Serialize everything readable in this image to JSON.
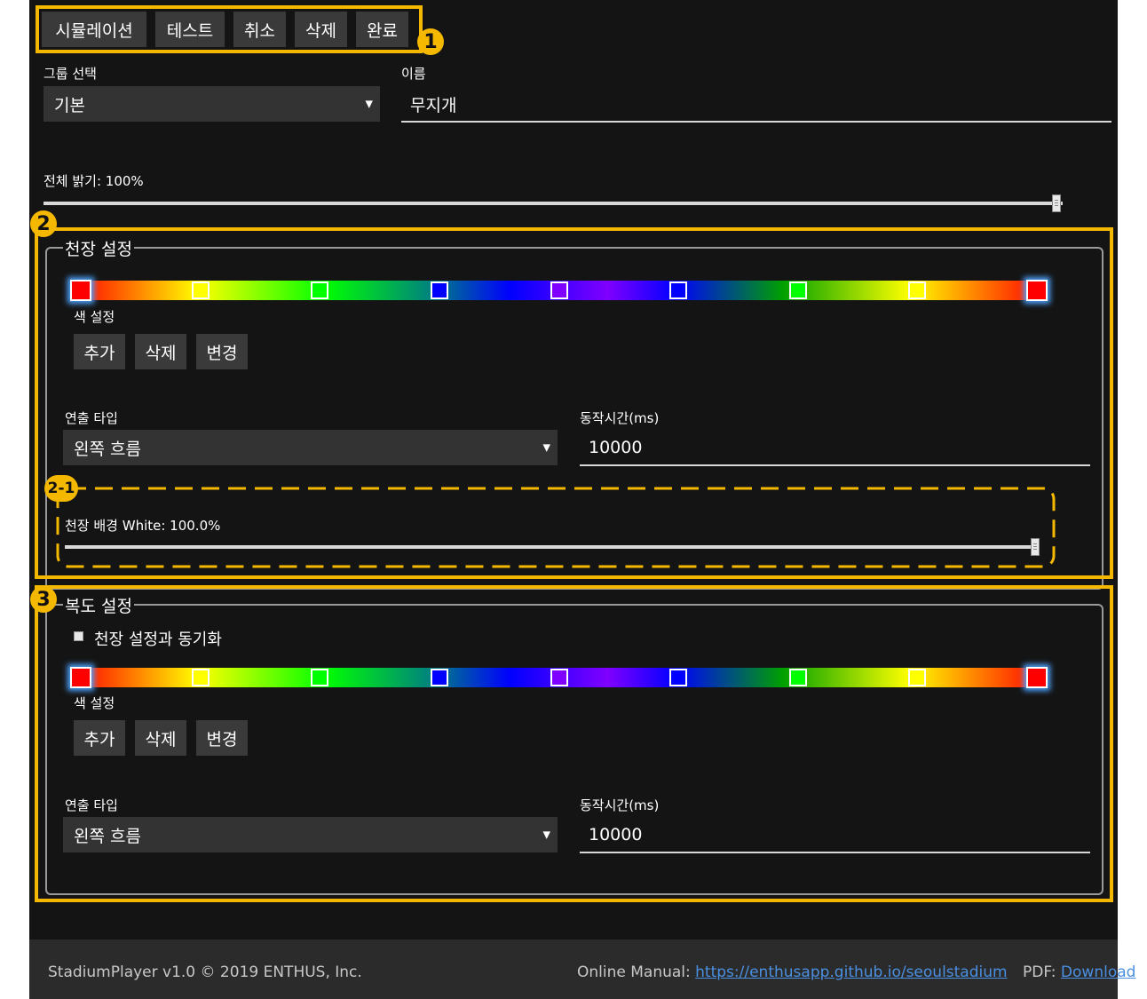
{
  "toolbar": {
    "simulation_label": "시뮬레이션",
    "test_label": "테스트",
    "cancel_label": "취소",
    "delete_label": "삭제",
    "done_label": "완료"
  },
  "form": {
    "group_label": "그룹 선택",
    "group_value": "기본",
    "name_label": "이름",
    "name_value": "무지개",
    "brightness_label": "전체 밝기: 100%",
    "brightness_value": 1.0
  },
  "ceiling": {
    "legend": "천장 설정",
    "color_stops": [
      "#ff0000",
      "#ffff00",
      "#00ff00",
      "#0000ff",
      "#8000ff",
      "#0000ff",
      "#00ff00",
      "#ffff00",
      "#ff0000"
    ],
    "color_setting_label": "색 설정",
    "add_label": "추가",
    "delete_label": "삭제",
    "change_label": "변경",
    "effect_type_label": "연출 타입",
    "effect_type_value": "왼쪽 흐름",
    "duration_label": "동작시간(ms)",
    "duration_value": "10000",
    "background_label": "천장 배경 White: 100.0%",
    "background_value": 1.0
  },
  "corridor": {
    "legend": "복도 설정",
    "sync_label": "천장 설정과 동기화",
    "sync_checked": false,
    "color_stops": [
      "#ff0000",
      "#ffff00",
      "#00ff00",
      "#0000ff",
      "#8000ff",
      "#0000ff",
      "#00ff00",
      "#ffff00",
      "#ff0000"
    ],
    "color_setting_label": "색 설정",
    "add_label": "추가",
    "delete_label": "삭제",
    "change_label": "변경",
    "effect_type_label": "연출 타입",
    "effect_type_value": "왼쪽 흐름",
    "duration_label": "동작시간(ms)",
    "duration_value": "10000"
  },
  "callouts": {
    "one": "1",
    "two": "2",
    "two_one": "2-1",
    "three": "3"
  },
  "footer": {
    "copyright": "StadiumPlayer v1.0 © 2019 ENTHUS, Inc.",
    "manual_label": "Online Manual:",
    "manual_link": "https://enthusapp.github.io/seoulstadium",
    "pdf_label": "PDF:",
    "pdf_link": "Download"
  },
  "colors": {
    "accent": "#f5b800",
    "background": "#141414",
    "link": "#4a90e2"
  }
}
